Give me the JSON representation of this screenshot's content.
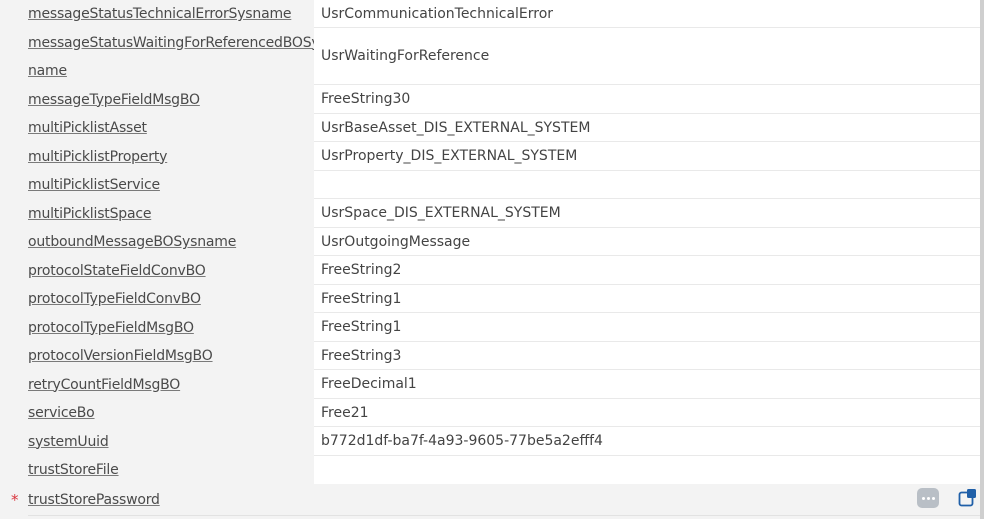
{
  "fields": [
    {
      "label": "messageStatusTechnicalErrorSysname",
      "value": "UsrCommunicationTechnicalError"
    },
    {
      "label_line1": "messageStatusWaitingForReferencedBOSys",
      "label_line2": "name",
      "value": "UsrWaitingForReference"
    },
    {
      "label": "messageTypeFieldMsgBO",
      "value": "FreeString30"
    },
    {
      "label": "multiPicklistAsset",
      "value": "UsrBaseAsset_DIS_EXTERNAL_SYSTEM"
    },
    {
      "label": "multiPicklistProperty",
      "value": "UsrProperty_DIS_EXTERNAL_SYSTEM"
    },
    {
      "label": "multiPicklistService",
      "value": ""
    },
    {
      "label": "multiPicklistSpace",
      "value": "UsrSpace_DIS_EXTERNAL_SYSTEM"
    },
    {
      "label": "outboundMessageBOSysname",
      "value": "UsrOutgoingMessage"
    },
    {
      "label": "protocolStateFieldConvBO",
      "value": "FreeString2"
    },
    {
      "label": "protocolTypeFieldConvBO",
      "value": "FreeString1"
    },
    {
      "label": "protocolTypeFieldMsgBO",
      "value": "FreeString1"
    },
    {
      "label": "protocolVersionFieldMsgBO",
      "value": "FreeString3"
    },
    {
      "label": "retryCountFieldMsgBO",
      "value": "FreeDecimal1"
    },
    {
      "label": "serviceBo",
      "value": "Free21"
    },
    {
      "label": "systemUuid",
      "value": "b772d1df-ba7f-4a93-9605-77be5a2efff4"
    },
    {
      "label": "trustStoreFile",
      "value": ""
    },
    {
      "label": "trustStorePassword",
      "value": "",
      "required_mark": "*"
    }
  ],
  "icons": {
    "more": "more-dots-icon",
    "open": "open-window-icon"
  },
  "colors": {
    "background": "#f3f3f3",
    "value_background": "#ffffff",
    "required": "#d9363e",
    "icon_gray": "#b9bfc6",
    "icon_blue": "#1f5fa8"
  }
}
